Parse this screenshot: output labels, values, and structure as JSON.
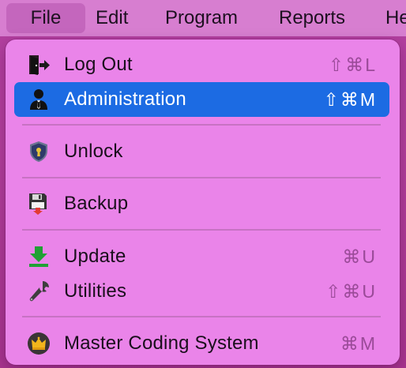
{
  "menubar": {
    "items": [
      {
        "label": "File"
      },
      {
        "label": "Edit"
      },
      {
        "label": "Program"
      },
      {
        "label": "Reports"
      },
      {
        "label": "He"
      }
    ]
  },
  "file_menu": {
    "items": [
      {
        "label": "Log Out",
        "shortcut": "⇧⌘L",
        "icon": "logout-door-icon"
      },
      {
        "label": "Administration",
        "shortcut": "⇧⌘M",
        "icon": "admin-person-icon",
        "highlighted": true
      },
      {
        "label": "Unlock",
        "shortcut": "",
        "icon": "shield-lock-icon"
      },
      {
        "label": "Backup",
        "shortcut": "",
        "icon": "floppy-disk-icon"
      },
      {
        "label": "Update",
        "shortcut": "⌘U",
        "icon": "download-arrow-icon"
      },
      {
        "label": "Utilities",
        "shortcut": "⇧⌘U",
        "icon": "wrench-icon"
      },
      {
        "label": "Master Coding System",
        "shortcut": "⌘M",
        "icon": "crown-badge-icon"
      }
    ]
  },
  "colors": {
    "menubar": "#d77ed0",
    "menu_background": "#ea84e9",
    "highlight": "#1c6be3",
    "shortcut_text": "#9a4a98"
  }
}
